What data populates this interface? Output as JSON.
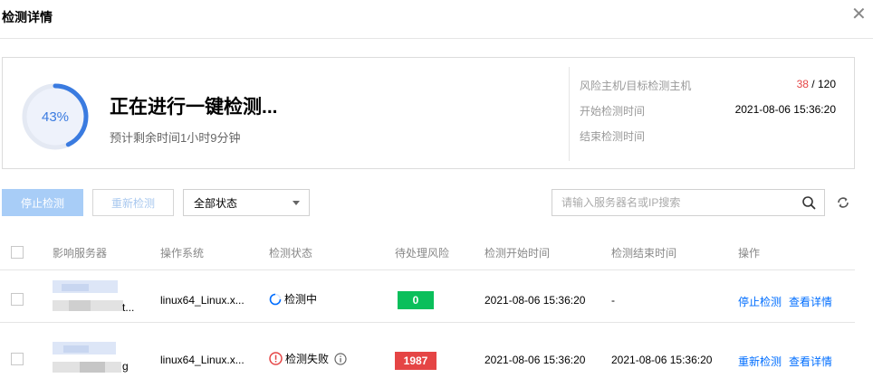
{
  "dialog": {
    "title": "检测详情"
  },
  "summary": {
    "progress_percent": 43,
    "progress_label": "43%",
    "heading": "正在进行一键检测...",
    "remaining": "预计剩余时间1小时9分钟",
    "risk_hosts_label": "风险主机/目标检测主机",
    "risk_count": "38",
    "risk_separator": " / ",
    "target_count": "120",
    "start_label": "开始检测时间",
    "start_value": "2021-08-06 15:36:20",
    "end_label": "结束检测时间"
  },
  "toolbar": {
    "stop_label": "停止检测",
    "retry_label": "重新检测",
    "status_filter": "全部状态",
    "search_placeholder": "请输入服务器名或IP搜索"
  },
  "table": {
    "columns": [
      "影响服务器",
      "操作系统",
      "检测状态",
      "待处理风险",
      "检测开始时间",
      "检测结束时间",
      "操作"
    ],
    "rows": [
      {
        "server_suffix": "t...",
        "os": "linux64_Linux.x...",
        "status": "检测中",
        "status_type": "running",
        "risk": "0",
        "risk_color": "#0abf5b",
        "start": "2021-08-06 15:36:20",
        "end": "-",
        "action1": "停止检测",
        "action2": "查看详情"
      },
      {
        "server_suffix": "g",
        "os": "linux64_Linux.x...",
        "status": "检测失败",
        "status_type": "failed",
        "risk": "1987",
        "risk_color": "#e54545",
        "start": "2021-08-06 15:36:20",
        "end": "2021-08-06 15:36:20",
        "action1": "重新检测",
        "action2": "查看详情"
      }
    ]
  },
  "colors": {
    "accent": "#006eff",
    "danger": "#e54545",
    "success": "#0abf5b",
    "ring": "#3a7be0"
  }
}
